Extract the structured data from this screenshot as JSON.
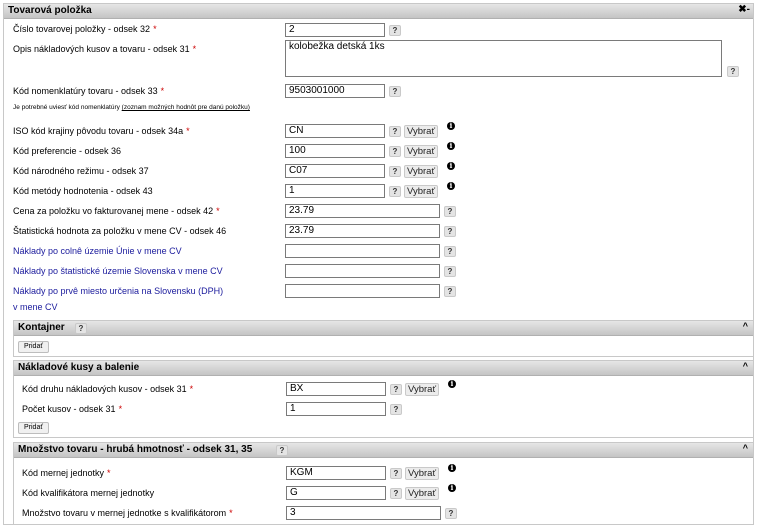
{
  "header": {
    "title": "Tovarová položka",
    "icons": "✖-"
  },
  "fields": {
    "cislo": {
      "label": "Číslo tovarovej položky - odsek 32",
      "value": "2"
    },
    "opis": {
      "label": "Opis nákladových kusov a tovaru - odsek 31",
      "value": "kolobežka detská 1ks"
    },
    "kod_nomen": {
      "label": "Kód nomenklatúry tovaru - odsek 33",
      "value": "9503001000"
    },
    "note": {
      "text": "Je potrebné uviesť kód nomenklatúry ",
      "link": "(zoznam možných hodnôt pre danú položku)"
    },
    "iso": {
      "label": "ISO kód krajiny pôvodu tovaru - odsek 34a",
      "value": "CN"
    },
    "pref": {
      "label": "Kód preferencie - odsek 36",
      "value": "100"
    },
    "rezim": {
      "label": "Kód národného režimu - odsek 37",
      "value": "C07"
    },
    "metoda": {
      "label": "Kód metódy hodnotenia - odsek 43",
      "value": "1"
    },
    "cena": {
      "label": "Cena za položku vo fakturovanej mene - odsek 42",
      "value": "23.79"
    },
    "stat": {
      "label": "Štatistická hodnota za položku v mene CV - odsek 46",
      "value": "23.79"
    },
    "naklady1": {
      "label": "Náklady po colnê územie Únie v mene CV",
      "value": ""
    },
    "naklady2": {
      "label": "Náklady po štatistické územie Slovenska v mene CV",
      "value": ""
    },
    "naklady3": {
      "label_line1": "Náklady po prvê miesto určenia na Slovensku (DPH)",
      "label_line2": "v mene CV",
      "value": ""
    }
  },
  "buttons": {
    "help": "?",
    "vybrat": "Vybrať",
    "info": "i",
    "pridat": "Pridať",
    "caret": "^",
    "req_mark": "*"
  },
  "kontajner": {
    "title": "Kontajner"
  },
  "naklad_kusy": {
    "title": "Nákladové kusy a balenie",
    "druh": {
      "label": "Kód druhu nákladových kusov - odsek 31",
      "value": "BX"
    },
    "pocet": {
      "label": "Počet kusov - odsek 31",
      "value": "1"
    }
  },
  "mnozstvo": {
    "title": "Množstvo tovaru - hrubá hmotnosť - odsek 31, 35",
    "mj": {
      "label": "Kód mernej jednotky",
      "value": "KGM"
    },
    "kval": {
      "label": "Kód kvalifikátora mernej jednotky",
      "value": "G"
    },
    "mnoz": {
      "label": "Množstvo tovaru v mernej jednotke s kvalifikátorom",
      "value": "3"
    }
  }
}
